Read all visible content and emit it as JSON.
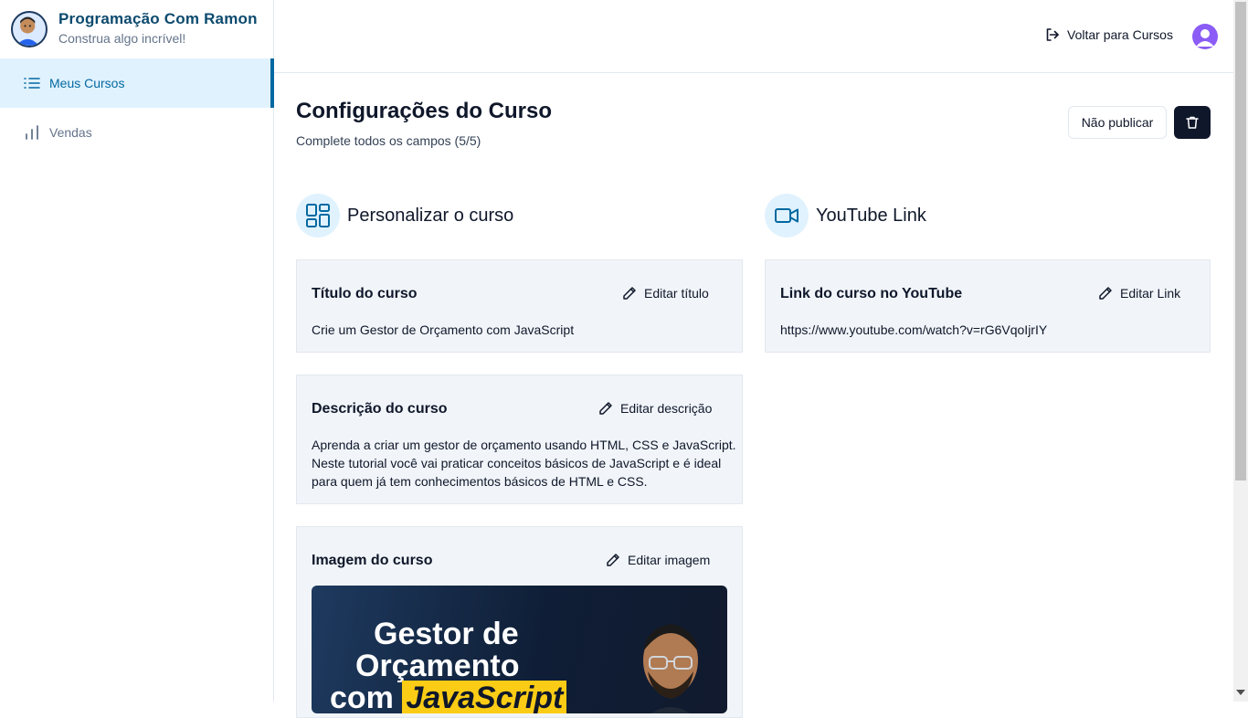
{
  "sidebar": {
    "brand_title": "Programação Com Ramon",
    "brand_subtitle": "Construa algo incrível!",
    "items": [
      {
        "label": "Meus Cursos",
        "icon": "list-icon",
        "active": true
      },
      {
        "label": "Vendas",
        "icon": "bar-chart-icon",
        "active": false
      }
    ]
  },
  "header": {
    "back_label": "Voltar para Cursos"
  },
  "page": {
    "title": "Configurações do Curso",
    "subtitle": "Complete todos os campos (5/5)",
    "unpublish_label": "Não publicar"
  },
  "sections": {
    "customize_title": "Personalizar o curso",
    "youtube_title": "YouTube Link"
  },
  "cards": {
    "title_card": {
      "label": "Título do curso",
      "edit_label": "Editar título",
      "value": "Crie um Gestor de Orçamento com JavaScript"
    },
    "description_card": {
      "label": "Descrição do curso",
      "edit_label": "Editar descrição",
      "value_line1": "Aprenda a criar um gestor de orçamento usando HTML, CSS e JavaScript.",
      "value_line2": "Neste tutorial você vai praticar conceitos básicos de JavaScript e é ideal",
      "value_line3": "para quem já tem conhecimentos básicos de HTML e CSS."
    },
    "image_card": {
      "label": "Imagem do curso",
      "edit_label": "Editar imagem",
      "image_line1": "Gestor de",
      "image_line2": "Orçamento",
      "image_line3_prefix": "com ",
      "image_line3_highlight": "JavaScript"
    },
    "youtube_card": {
      "label": "Link do curso no YouTube",
      "edit_label": "Editar Link",
      "value": "https://www.youtube.com/watch?v=rG6VqoIjrIY"
    }
  },
  "colors": {
    "accent": "#0369a1",
    "active_bg": "#e0f2fe",
    "card_bg": "#f1f5f9",
    "dark_button": "#0f172a",
    "highlight": "#facc15"
  }
}
